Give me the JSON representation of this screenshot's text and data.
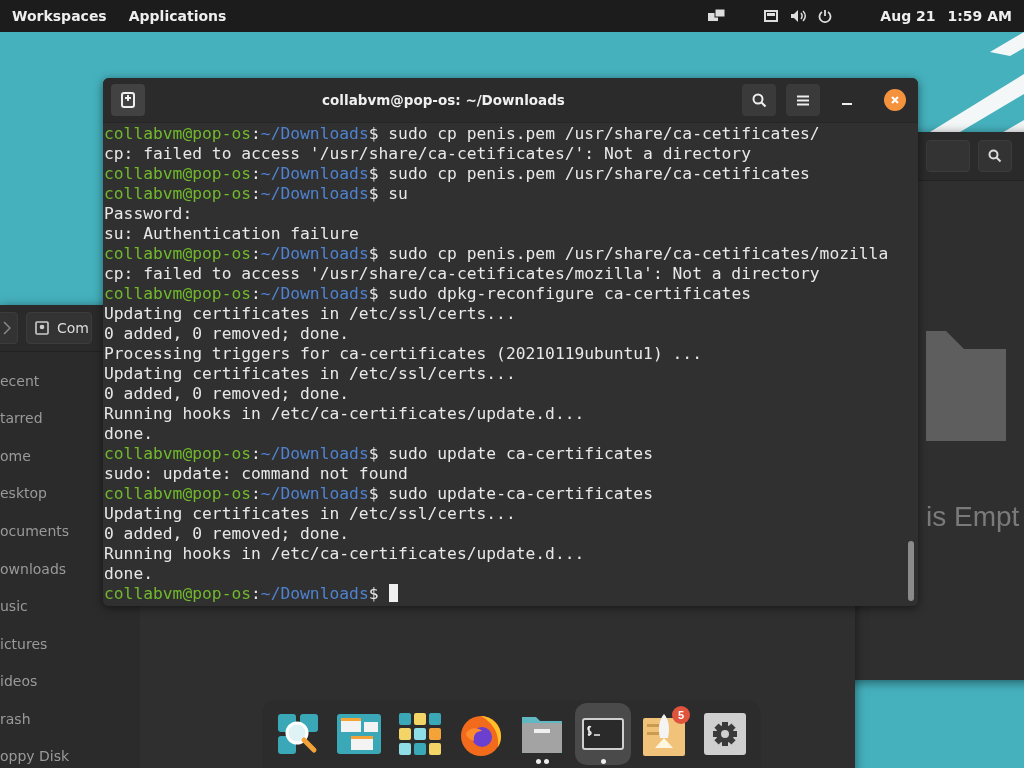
{
  "top_bar": {
    "menus": [
      {
        "label": "Workspaces"
      },
      {
        "label": "Applications"
      }
    ],
    "date": "Aug 21",
    "time": "1:59 AM"
  },
  "back_window": {
    "is_empty_text": "is Empt"
  },
  "file_window": {
    "path_label": "Com",
    "sidebar": [
      {
        "label": "ecent"
      },
      {
        "label": "tarred"
      },
      {
        "label": "ome"
      },
      {
        "label": "esktop"
      },
      {
        "label": "ocuments"
      },
      {
        "label": "ownloads"
      },
      {
        "label": "usic"
      },
      {
        "label": "ictures"
      },
      {
        "label": "ideos"
      },
      {
        "label": "rash"
      },
      {
        "label": "oppy Disk"
      }
    ]
  },
  "terminal": {
    "title": "collabvm@pop-os: ~/Downloads",
    "lines": [
      {
        "kind": "prompt",
        "user": "collabvm@pop-os",
        "separator": ":",
        "path": "~/Downloads",
        "symbol": "$",
        "command": "sudo cp penis.pem /usr/share/ca-cetificates/"
      },
      {
        "kind": "output",
        "text": "cp: failed to access '/usr/share/ca-cetificates/': Not a directory"
      },
      {
        "kind": "prompt",
        "user": "collabvm@pop-os",
        "separator": ":",
        "path": "~/Downloads",
        "symbol": "$",
        "command": "sudo cp penis.pem /usr/share/ca-cetificates"
      },
      {
        "kind": "prompt",
        "user": "collabvm@pop-os",
        "separator": ":",
        "path": "~/Downloads",
        "symbol": "$",
        "command": "su"
      },
      {
        "kind": "output",
        "text": "Password:"
      },
      {
        "kind": "output",
        "text": "su: Authentication failure"
      },
      {
        "kind": "prompt",
        "user": "collabvm@pop-os",
        "separator": ":",
        "path": "~/Downloads",
        "symbol": "$",
        "command": "sudo cp penis.pem /usr/share/ca-cetificates/mozilla"
      },
      {
        "kind": "output",
        "text": "cp: failed to access '/usr/share/ca-cetificates/mozilla': Not a directory"
      },
      {
        "kind": "prompt",
        "user": "collabvm@pop-os",
        "separator": ":",
        "path": "~/Downloads",
        "symbol": "$",
        "command": "sudo dpkg-reconfigure ca-certificates"
      },
      {
        "kind": "output",
        "text": "Updating certificates in /etc/ssl/certs..."
      },
      {
        "kind": "output",
        "text": "0 added, 0 removed; done."
      },
      {
        "kind": "output",
        "text": "Processing triggers for ca-certificates (20210119ubuntu1) ..."
      },
      {
        "kind": "output",
        "text": "Updating certificates in /etc/ssl/certs..."
      },
      {
        "kind": "output",
        "text": "0 added, 0 removed; done."
      },
      {
        "kind": "output",
        "text": "Running hooks in /etc/ca-certificates/update.d..."
      },
      {
        "kind": "output",
        "text": "done."
      },
      {
        "kind": "prompt",
        "user": "collabvm@pop-os",
        "separator": ":",
        "path": "~/Downloads",
        "symbol": "$",
        "command": "sudo update ca-certificates"
      },
      {
        "kind": "output",
        "text": "sudo: update: command not found"
      },
      {
        "kind": "prompt",
        "user": "collabvm@pop-os",
        "separator": ":",
        "path": "~/Downloads",
        "symbol": "$",
        "command": "sudo update-ca-certificates"
      },
      {
        "kind": "output",
        "text": "Updating certificates in /etc/ssl/certs..."
      },
      {
        "kind": "output",
        "text": "0 added, 0 removed; done."
      },
      {
        "kind": "output",
        "text": "Running hooks in /etc/ca-certificates/update.d..."
      },
      {
        "kind": "output",
        "text": "done."
      },
      {
        "kind": "prompt",
        "user": "collabvm@pop-os",
        "separator": ":",
        "path": "~/Downloads",
        "symbol": "$",
        "cursor": true
      }
    ]
  },
  "dock": {
    "items": [
      {
        "kind": "search",
        "selected": false,
        "running": false
      },
      {
        "kind": "workspaces",
        "selected": false,
        "running": false
      },
      {
        "kind": "apps",
        "selected": false,
        "running": false
      },
      {
        "kind": "browser",
        "selected": false,
        "running": false
      },
      {
        "kind": "files",
        "selected": false,
        "running": true,
        "multiple": true
      },
      {
        "kind": "terminal",
        "selected": true,
        "running": true,
        "multiple": false
      },
      {
        "kind": "store",
        "selected": false,
        "running": false,
        "badge": "5"
      },
      {
        "kind": "settings",
        "selected": false,
        "running": false
      }
    ]
  }
}
